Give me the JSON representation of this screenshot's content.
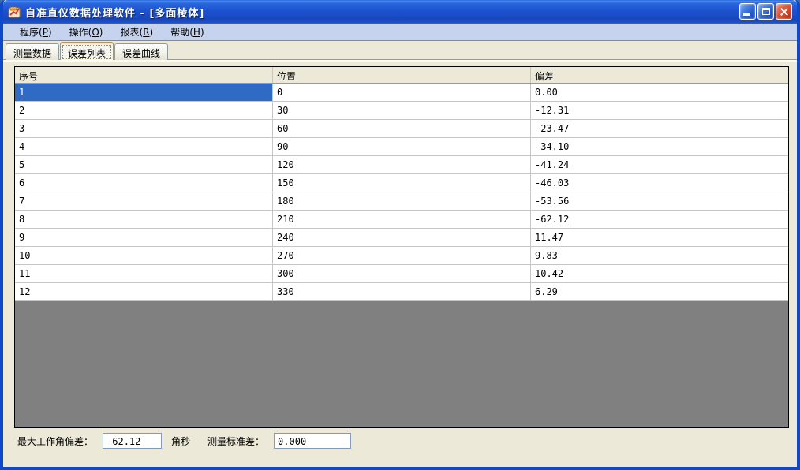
{
  "window": {
    "title": "自准直仪数据处理软件 - [多面棱体]"
  },
  "icons": {
    "app": "app-icon",
    "minimize": "minimize-icon",
    "maximize": "maximize-icon",
    "close": "close-icon"
  },
  "menu": {
    "paren_open": "(",
    "paren_close": ")",
    "items": [
      {
        "label": "程序",
        "hotkey": "P"
      },
      {
        "label": "操作",
        "hotkey": "O"
      },
      {
        "label": "报表",
        "hotkey": "R"
      },
      {
        "label": "帮助",
        "hotkey": "H"
      }
    ]
  },
  "tabs": {
    "active": "误差列表",
    "items": [
      {
        "label": "测量数据"
      },
      {
        "label": "误差列表"
      },
      {
        "label": "误差曲线"
      }
    ]
  },
  "table": {
    "headers": {
      "seq": "序号",
      "pos": "位置",
      "dev": "偏差"
    },
    "selected_seq": "1",
    "rows": [
      {
        "seq": "1",
        "pos": "0",
        "dev": "0.00"
      },
      {
        "seq": "2",
        "pos": "30",
        "dev": "-12.31"
      },
      {
        "seq": "3",
        "pos": "60",
        "dev": "-23.47"
      },
      {
        "seq": "4",
        "pos": "90",
        "dev": "-34.10"
      },
      {
        "seq": "5",
        "pos": "120",
        "dev": "-41.24"
      },
      {
        "seq": "6",
        "pos": "150",
        "dev": "-46.03"
      },
      {
        "seq": "7",
        "pos": "180",
        "dev": "-53.56"
      },
      {
        "seq": "8",
        "pos": "210",
        "dev": "-62.12"
      },
      {
        "seq": "9",
        "pos": "240",
        "dev": "11.47"
      },
      {
        "seq": "10",
        "pos": "270",
        "dev": "9.83"
      },
      {
        "seq": "11",
        "pos": "300",
        "dev": "10.42"
      },
      {
        "seq": "12",
        "pos": "330",
        "dev": "6.29"
      }
    ]
  },
  "footer": {
    "max_label": "最大工作角偏差：",
    "max_value": "-62.12",
    "max_unit": "角秒",
    "std_label": "测量标准差：",
    "std_value": "0.000"
  },
  "colors": {
    "selection_blue": "#2f6bc5",
    "title_blue": "#1d52cf",
    "menu_bar": "#c5d3ef",
    "client_bg": "#ece9d8",
    "grid_line": "#c6c6c6",
    "filler_gray": "#808080",
    "tab_active_top": "#e5832c",
    "input_border": "#7f9db9",
    "close_red": "#cf3917"
  }
}
